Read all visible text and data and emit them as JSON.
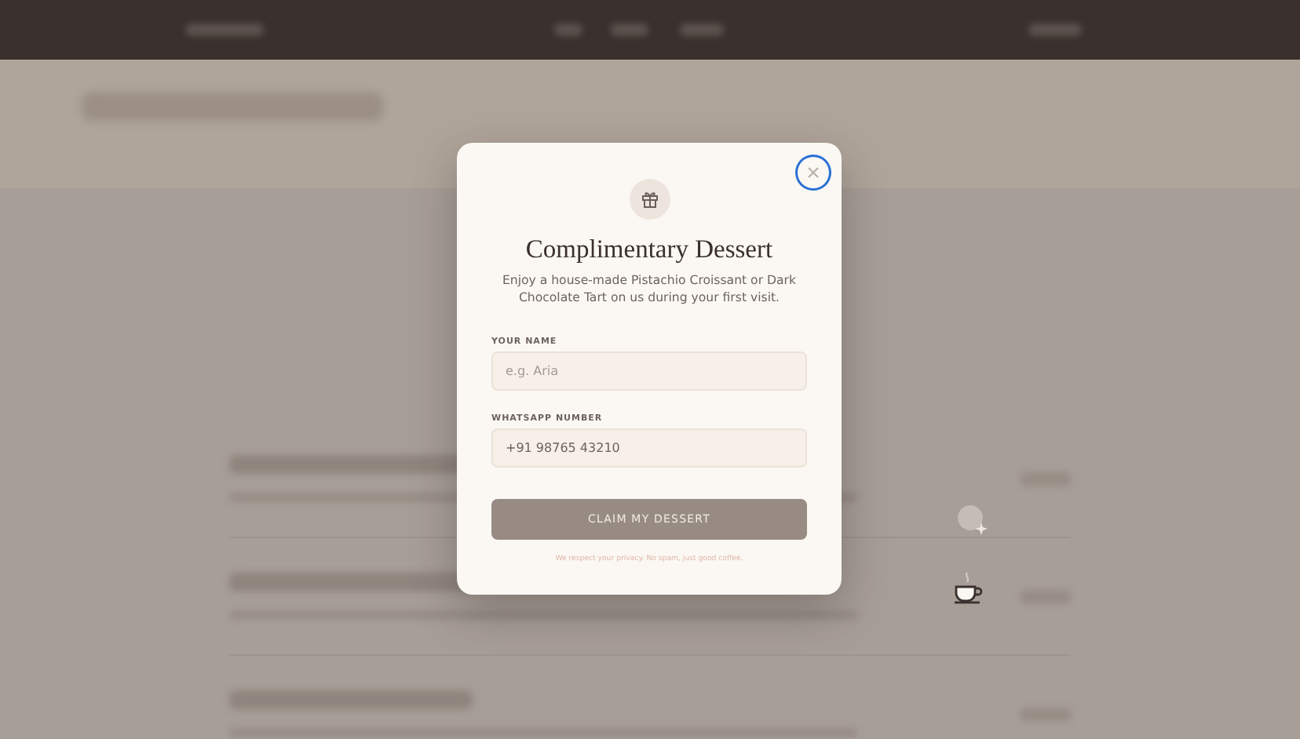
{
  "modal": {
    "title": "Complimentary Dessert",
    "description": "Enjoy a house-made Pistachio Croissant or Dark Chocolate Tart on us during your first visit.",
    "close_button": {
      "focused": true
    },
    "fields": [
      {
        "label": "YOUR NAME",
        "placeholder": "e.g. Aria"
      },
      {
        "label": "WHATSAPP NUMBER",
        "value": "+91 98765 43210"
      }
    ],
    "submit": {
      "label": "CLAIM MY DESSERT",
      "disabled": true
    },
    "note": "We respect your privacy. No spam, just good coffee."
  }
}
